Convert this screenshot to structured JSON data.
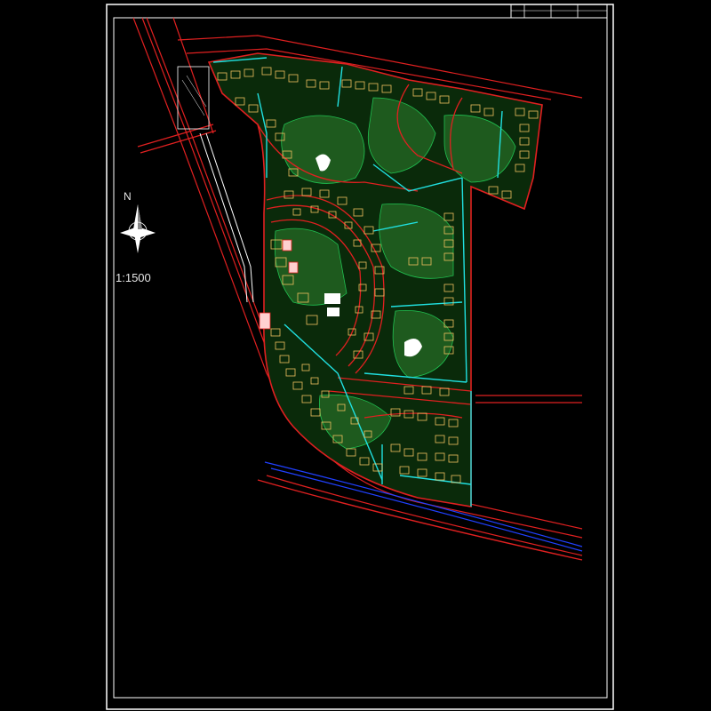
{
  "drawing": {
    "north_label": "N",
    "scale_label": "1:1500"
  },
  "colors": {
    "background": "#000000",
    "frame": "#ffffff",
    "road": "#e02020",
    "green_area": "#1e5a1e",
    "building": "#f0c060",
    "path": "#20e0e0",
    "waterline": "#2040ff",
    "pale": "#ffd0d0"
  }
}
